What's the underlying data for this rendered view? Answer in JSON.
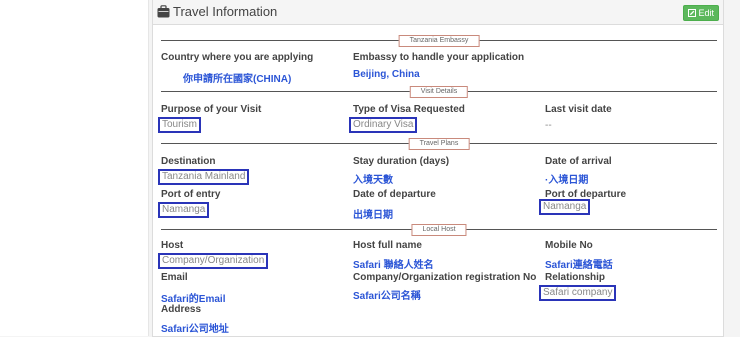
{
  "panel": {
    "title": "Travel Information",
    "edit_label": "Edit"
  },
  "sections": {
    "embassy": "Tanzania Embassy",
    "visit": "Visit Details",
    "travel": "Travel Plans",
    "host": "Local Host"
  },
  "fields": {
    "country_label": "Country where you are applying",
    "country_value": "你申請所在國家(CHINA)",
    "embassy_label": "Embassy to handle your application",
    "embassy_value": "Beijing, China",
    "purpose_label": "Purpose of your Visit",
    "purpose_value": "Tourism",
    "visa_type_label": "Type of Visa Requested",
    "visa_type_value": "Ordinary Visa",
    "last_visit_label": "Last visit date",
    "last_visit_value": "--",
    "destination_label": "Destination",
    "destination_value": "Tanzania Mainland",
    "stay_label": "Stay duration (days)",
    "stay_value": "入境天數",
    "arrival_label": "Date of arrival",
    "arrival_value": "·入境日期",
    "entry_port_label": "Port of entry",
    "entry_port_value": "Namanga",
    "departure_date_label": "Date of departure",
    "departure_date_value": "出境日期",
    "departure_port_label": "Port of departure",
    "departure_port_value": "Namanga",
    "host_label": "Host",
    "host_value": "Company/Organization",
    "host_name_label": "Host full name",
    "host_name_value": "Safari 聯絡人姓名",
    "mobile_label": "Mobile No",
    "mobile_value": "Safari連絡電話",
    "email_label": "Email",
    "email_value": "Safari的Email",
    "reg_label": "Company/Organization registration No",
    "reg_value": "Safari公司名稱",
    "relationship_label": "Relationship",
    "relationship_value": "Safari company",
    "address_label": "Address",
    "address_value": "Safari公司地址"
  },
  "colors": {
    "highlight_border": "#2a34b8",
    "blue_text": "#2b55d6",
    "edit_green": "#5cb85c",
    "section_tag_border": "#c98a7c"
  }
}
